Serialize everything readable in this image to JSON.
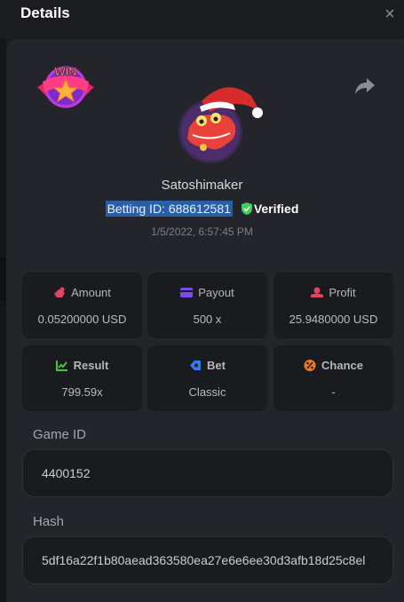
{
  "header": {
    "title": "Details",
    "close_glyph": "×"
  },
  "profile": {
    "badge_text": "WIN",
    "username": "Satoshimaker",
    "betting_id": "Betting ID: 688612581",
    "verified_label": "Verified",
    "datetime": "1/5/2022, 6:57:45 PM"
  },
  "stats": [
    {
      "label": "Amount",
      "value": "0.05200000 USD",
      "icon": "amount-icon",
      "color": "#e0445e"
    },
    {
      "label": "Payout",
      "value": "500 x",
      "icon": "payout-icon",
      "color": "#7a4cf0"
    },
    {
      "label": "Profit",
      "value": "25.9480000 USD",
      "icon": "profit-icon",
      "color": "#e0445e"
    },
    {
      "label": "Result",
      "value": "799.59x",
      "icon": "result-icon",
      "color": "#4fc23c"
    },
    {
      "label": "Bet",
      "value": "Classic",
      "icon": "bet-icon",
      "color": "#2f7bf2"
    },
    {
      "label": "Chance",
      "value": "-",
      "icon": "chance-icon",
      "color": "#f07a22"
    }
  ],
  "game": {
    "label": "Game ID",
    "value": "4400152"
  },
  "hash": {
    "label": "Hash",
    "value": "5df16a22f1b80aead363580ea27e6e6ee30d3afb18d25c8el"
  },
  "colors": {
    "verified": "#3fcf5c",
    "selection": "#2a5fa8",
    "panel": "#23252a"
  }
}
